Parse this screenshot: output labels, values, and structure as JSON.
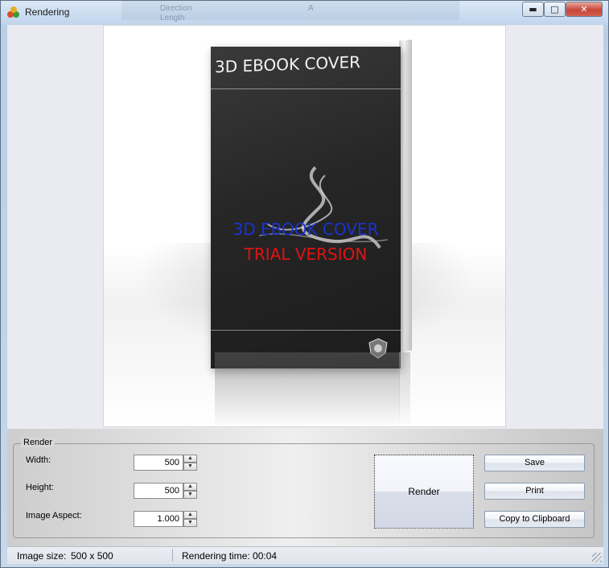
{
  "window": {
    "title": "Rendering",
    "background_titles": [
      "Direction",
      "A",
      "Length"
    ]
  },
  "preview": {
    "cover_title": "3D EBOOK COVER",
    "watermark_line1": "3D EBOOK COVER",
    "watermark_line2": "TRIAL VERSION"
  },
  "render_group": {
    "legend": "Render",
    "width_label": "Width:",
    "width_value": "500",
    "height_label": "Height:",
    "height_value": "500",
    "aspect_label": "Image Aspect:",
    "aspect_value": "1.000",
    "render_button": "Render"
  },
  "actions": {
    "save": "Save",
    "print": "Print",
    "copy": "Copy to Clipboard"
  },
  "status": {
    "image_size_label": "Image size:",
    "image_size_value": "500 x 500",
    "rendering_time": "Rendering time: 00:04"
  },
  "colors": {
    "watermark_blue": "#1a33d0",
    "watermark_red": "#e01313",
    "close_button": "#c7443a"
  }
}
